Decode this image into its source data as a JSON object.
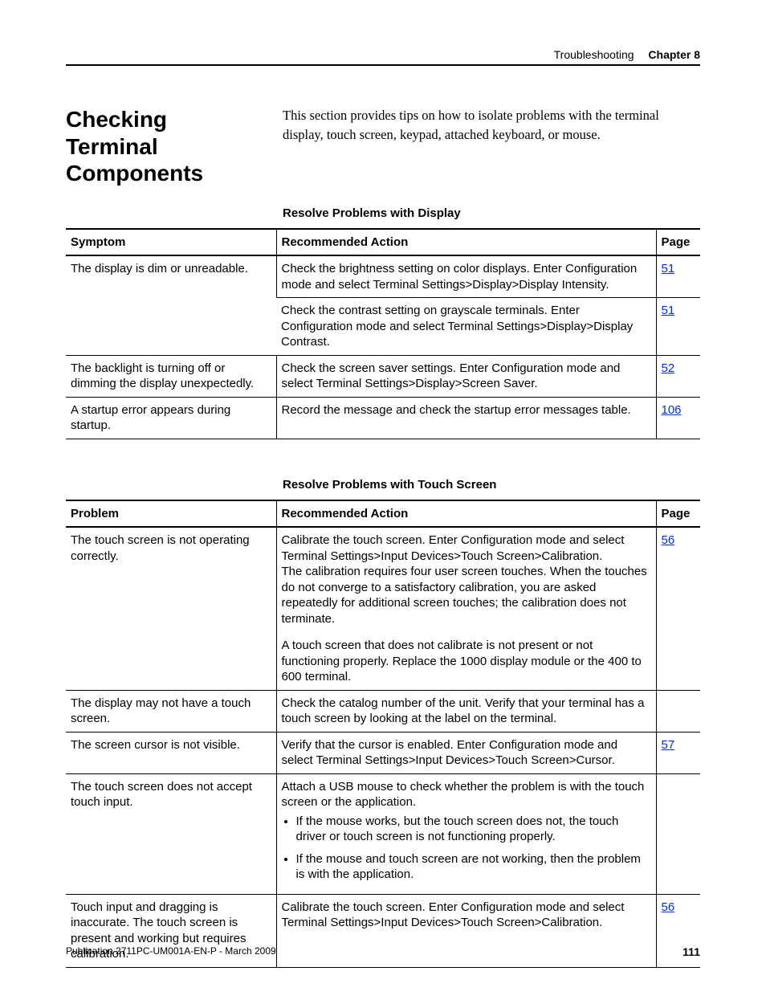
{
  "header": {
    "section": "Troubleshooting",
    "chapter": "Chapter 8"
  },
  "heading": "Checking Terminal Components",
  "intro": "This section provides tips on how to isolate problems with the terminal display, touch screen, keypad, attached keyboard, or mouse.",
  "table1": {
    "title": "Resolve Problems with Display",
    "col1": "Symptom",
    "col2": "Recommended Action",
    "col3": "Page",
    "rows": {
      "r1c1": "The display is dim or unreadable.",
      "r1c2": "Check the brightness setting on color displays. Enter Configuration mode and select Terminal Settings>Display>Display Intensity.",
      "r1c3": "51",
      "r2c2": "Check the contrast setting on grayscale terminals. Enter Configuration mode and select Terminal Settings>Display>Display Contrast.",
      "r2c3": "51",
      "r3c1": "The backlight is turning off or dimming the display unexpectedly.",
      "r3c2": "Check the screen saver settings. Enter Configuration mode and select Terminal Settings>Display>Screen Saver.",
      "r3c3": "52",
      "r4c1": "A startup error appears during startup.",
      "r4c2": "Record the message and check the startup error messages table.",
      "r4c3": "106"
    }
  },
  "table2": {
    "title": "Resolve Problems with Touch Screen",
    "col1": "Problem",
    "col2": "Recommended Action",
    "col3": "Page",
    "rows": {
      "r1c1": "The touch screen is not operating correctly.",
      "r1c2a": "Calibrate the touch screen. Enter Configuration mode and select Terminal Settings>Input Devices>Touch Screen>Calibration.",
      "r1c2b": "The calibration requires four user screen touches. When the touches do not converge to a satisfactory calibration, you are asked repeatedly for additional screen touches; the calibration does not terminate.",
      "r1c2c": "A touch screen that does not calibrate is not present or not functioning properly. Replace the 1000 display module or the 400 to 600 terminal.",
      "r1c3": "56",
      "r2c1": "The display may not have a touch screen.",
      "r2c2": "Check the catalog number of the unit. Verify that your terminal has a touch screen by looking at the label on the terminal.",
      "r3c1": "The screen cursor is not visible.",
      "r3c2": "Verify that the cursor is enabled. Enter Configuration mode and select Terminal Settings>Input Devices>Touch Screen>Cursor.",
      "r3c3": "57",
      "r4c1": "The touch screen does not accept touch input.",
      "r4c2a": "Attach a USB mouse to check whether the problem is with the touch screen or the application.",
      "r4c2b1": "If the mouse works, but the touch screen does not, the touch driver or touch screen is not functioning properly.",
      "r4c2b2": "If the mouse and touch screen are not working, then the problem is with the application.",
      "r5c1": "Touch input and dragging is inaccurate. The touch screen is present and working but requires calibration.",
      "r5c2": "Calibrate the touch screen. Enter Configuration mode and select Terminal Settings>Input Devices>Touch Screen>Calibration.",
      "r5c3": "56"
    }
  },
  "footer": {
    "pub": "Publication 2711PC-UM001A-EN-P - March 2009",
    "page": "111"
  }
}
